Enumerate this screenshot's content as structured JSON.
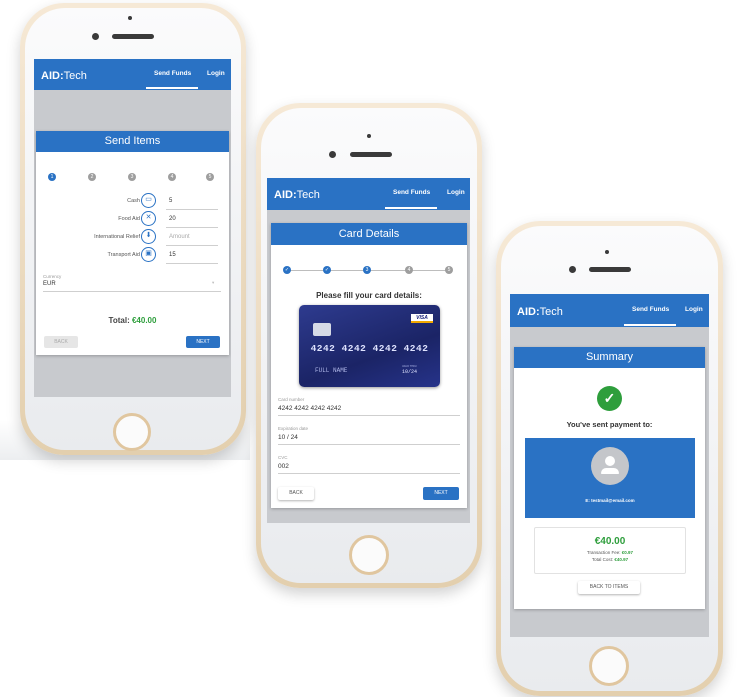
{
  "app": {
    "logo_bold": "AID:",
    "logo_light": "Tech",
    "nav_send_funds": "Send Funds",
    "nav_login": "Login"
  },
  "screen1": {
    "title": "Send Items",
    "steps": [
      "1",
      "2",
      "3",
      "4",
      "5"
    ],
    "items": [
      {
        "label": "Cash",
        "icon": "cash-icon",
        "value": "5"
      },
      {
        "label": "Food Aid",
        "icon": "food-aid-icon",
        "value": "20"
      },
      {
        "label": "International Relief",
        "icon": "relief-icon",
        "value": ""
      },
      {
        "label": "Transport Aid",
        "icon": "transport-icon",
        "value": "15"
      }
    ],
    "amount_placeholder": "Amount",
    "currency_label": "Currency",
    "currency_value": "EUR",
    "total_label": "Total:",
    "total_value": "€40.00",
    "back_label": "BACK",
    "next_label": "NEXT"
  },
  "screen2": {
    "title": "Card Details",
    "steps": [
      "✓",
      "✓",
      "3",
      "4",
      "5"
    ],
    "prompt": "Please fill your card details:",
    "card_brand": "VISA",
    "card_number_display": "4242 4242 4242 4242",
    "card_name_display": "FULL NAME",
    "card_valid_label": "VALID THRU",
    "card_expiry_display": "10/24",
    "number_label": "Card number",
    "number_value": "4242 4242 4242 4242",
    "expiry_label": "Expiration date",
    "expiry_value": "10 / 24",
    "cvc_label": "CVC",
    "cvc_value": "002",
    "back_label": "BACK",
    "next_label": "NEXT"
  },
  "screen3": {
    "title": "Summary",
    "sent_text": "You've sent payment to:",
    "email_prefix": "E:",
    "email": "testmail@email.com",
    "amount": "€40.00",
    "fee_label": "Transaction Fee:",
    "fee_value": "€0.97",
    "total_label": "Total Cost:",
    "total_value": "€40.97",
    "back_to_items_label": "BACK TO ITEMS"
  },
  "colors": {
    "primary": "#2a72c4",
    "success": "#2e9e3c",
    "phone_gold": "#e3cfae"
  }
}
